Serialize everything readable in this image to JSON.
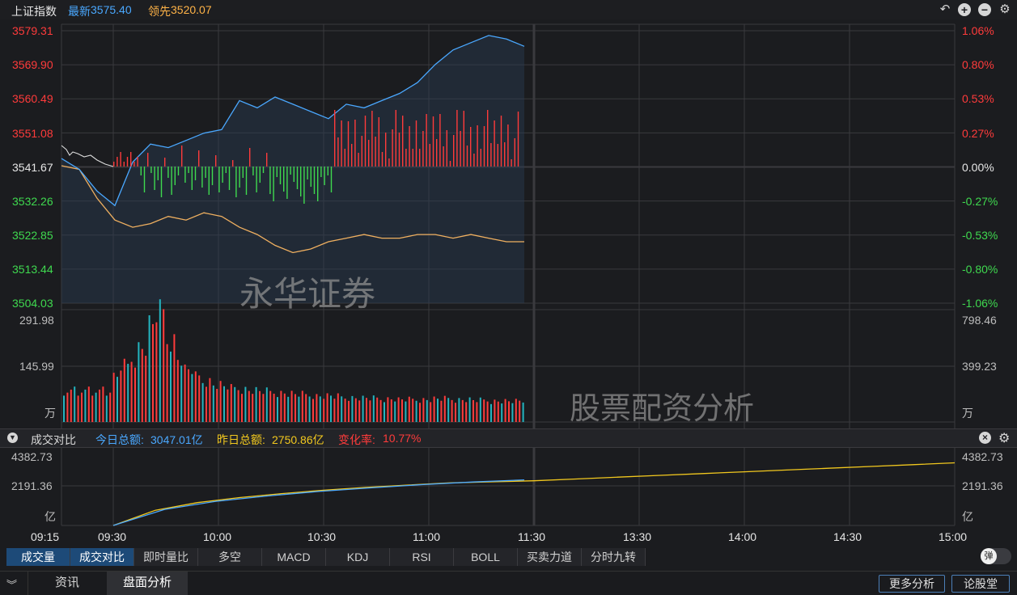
{
  "header": {
    "index_name": "上证指数",
    "latest_label": "最新",
    "latest_value": "3575.40",
    "lead_label": "领先",
    "lead_value": "3520.07",
    "icons": [
      "undo-icon",
      "zoom-in-icon",
      "zoom-out-icon",
      "gear-icon"
    ]
  },
  "colors": {
    "up": "#ff3b3b",
    "down": "#3fd94f",
    "price": "#4aa8ff",
    "avg": "#f0b060",
    "yellow": "#f2c81e",
    "grid": "#3a3a3e"
  },
  "price_axis": {
    "left": [
      "3579.31",
      "3569.90",
      "3560.49",
      "3551.08",
      "3541.67",
      "3532.26",
      "3522.85",
      "3513.44",
      "3504.03"
    ],
    "right": [
      "1.06%",
      "0.80%",
      "0.53%",
      "0.27%",
      "0.00%",
      "-0.27%",
      "-0.53%",
      "-0.80%",
      "-1.06%"
    ]
  },
  "volume_axis": {
    "left": [
      "291.98",
      "145.99",
      "万"
    ],
    "right": [
      "798.46",
      "399.23",
      "万"
    ]
  },
  "watermarks": {
    "main": "永华证券",
    "volume": "股票配资分析"
  },
  "turnover_panel": {
    "title": "成交对比",
    "today_label": "今日总额:",
    "today_value": "3047.01亿",
    "yesterday_label": "昨日总额:",
    "yesterday_value": "2750.86亿",
    "change_label": "变化率:",
    "change_value": "10.77%",
    "axis_left": [
      "4382.73",
      "2191.36",
      "亿"
    ],
    "axis_right": [
      "4382.73",
      "2191.36",
      "亿"
    ]
  },
  "time_axis": [
    "09:15",
    "09:30",
    "10:00",
    "10:30",
    "11:00",
    "11:30",
    "13:30",
    "14:00",
    "14:30",
    "15:00"
  ],
  "indicator_tabs": [
    "成交量",
    "成交对比",
    "即时量比",
    "多空",
    "MACD",
    "KDJ",
    "RSI",
    "BOLL",
    "买卖力道",
    "分时九转"
  ],
  "toggle_label": "弹",
  "bottom_bar": {
    "tabs": [
      "资讯",
      "盘面分析"
    ],
    "buttons": [
      "更多分析",
      "论股堂"
    ]
  },
  "chart_data": [
    {
      "type": "line",
      "title": "",
      "ylim": [
        3504.03,
        3579.31
      ],
      "series": [
        {
          "values": [
            3544,
            3541,
            3535,
            3531,
            3543,
            3548,
            3547,
            3549,
            3551,
            3552,
            3560,
            3558,
            3561,
            3559,
            3557,
            3555,
            3559,
            3558,
            3560,
            3562,
            3565,
            3570,
            3574,
            3576,
            3578,
            3577,
            3575
          ]
        },
        {
          "values": [
            3542,
            3541,
            3533,
            3527,
            3525,
            3526,
            3528,
            3527,
            3529,
            3528,
            3525,
            3523,
            3520,
            3518,
            3519,
            3521,
            3522,
            3523,
            3522,
            3522,
            3523,
            3523,
            3522,
            3523,
            3522,
            3521,
            3521
          ]
        }
      ]
    },
    {
      "type": "bar",
      "title": "",
      "ylim": [
        0,
        291.98
      ],
      "values": [
        75,
        80,
        78,
        72,
        90,
        120,
        150,
        170,
        200,
        260,
        291,
        220,
        170,
        140,
        120,
        110,
        100,
        95,
        90,
        88,
        85,
        82,
        80,
        78,
        76,
        74,
        72,
        70,
        70,
        68,
        66,
        65,
        64,
        63,
        62,
        62,
        60,
        60,
        60,
        60,
        62,
        62,
        60,
        60,
        58,
        58,
        56,
        56,
        55,
        55
      ]
    },
    {
      "type": "line",
      "title": "",
      "ylim": [
        0,
        4382.73
      ],
      "series": [
        {
          "values": [
            0,
            900,
            1350,
            1650,
            1900,
            2100,
            2280,
            2430,
            2550
          ]
        },
        {
          "values": [
            0,
            850,
            1280,
            1560,
            1780,
            1970,
            2130,
            2260,
            2380,
            2440,
            2500,
            2600,
            2700,
            2800,
            2900,
            3000,
            3100,
            3200,
            3300,
            3400,
            3500
          ]
        }
      ]
    }
  ]
}
